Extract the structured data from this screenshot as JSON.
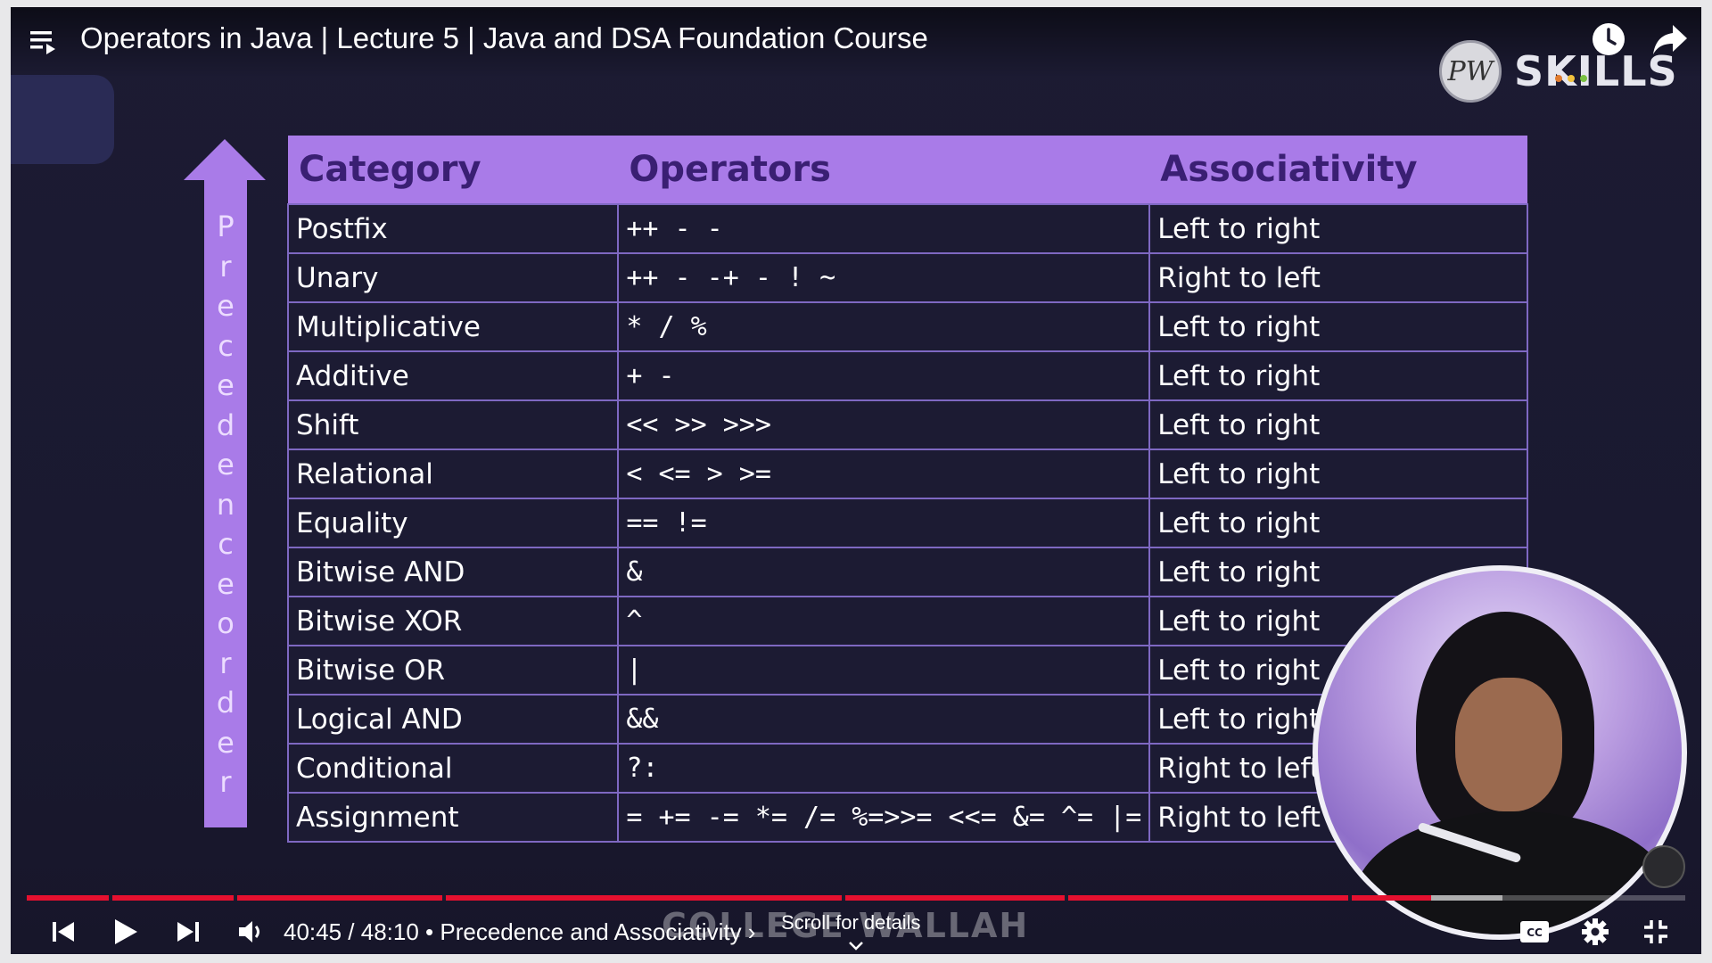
{
  "header": {
    "title": "Operators in Java | Lecture 5 | Java and DSA Foundation Course"
  },
  "brand": {
    "logo_text": "PW",
    "name": "SKILLS",
    "dot_colors": [
      "#e07b2f",
      "#f2c23c",
      "#7ac142"
    ]
  },
  "precedence_label": [
    "P",
    "r",
    "e",
    "c",
    "e",
    "d",
    "e",
    "n",
    "c",
    "e",
    "o",
    "r",
    "d",
    "e",
    "r"
  ],
  "table": {
    "headers": [
      "Category",
      "Operators",
      "Associativity"
    ],
    "rows": [
      {
        "category": "Postfix",
        "operators": "++ - -",
        "associativity": "Left to right"
      },
      {
        "category": "Unary",
        "operators": "++ - -+ - ! ~",
        "associativity": "Right to left"
      },
      {
        "category": "Multiplicative",
        "operators": "* / %",
        "associativity": "Left to right"
      },
      {
        "category": "Additive",
        "operators": "+ -",
        "associativity": "Left to right"
      },
      {
        "category": "Shift",
        "operators": "<<  >> >>>",
        "associativity": "Left to right"
      },
      {
        "category": "Relational",
        "operators": "< <= > >=",
        "associativity": "Left to right"
      },
      {
        "category": "Equality",
        "operators": "== !=",
        "associativity": "Left to right"
      },
      {
        "category": "Bitwise AND",
        "operators": "&",
        "associativity": "Left to right"
      },
      {
        "category": "Bitwise XOR",
        "operators": "^",
        "associativity": "Left to right"
      },
      {
        "category": "Bitwise OR",
        "operators": "|",
        "associativity": "Left to right"
      },
      {
        "category": "Logical AND",
        "operators": "&&",
        "associativity": "Left to right"
      },
      {
        "category": "Conditional",
        "operators": "?:",
        "associativity": "Right to left"
      },
      {
        "category": "Assignment",
        "operators": "= += -= *= /= %=>>= <<= &= ^= |=",
        "associativity": "Right to left"
      }
    ]
  },
  "watermark": "COLLEGE WALLAH",
  "player": {
    "time_display": "40:45 / 48:10",
    "chapter": "• Precedence and Associativity ›",
    "scroll_hint": "Scroll for details",
    "progress_played": 0.8466,
    "progress_buffered": 0.89,
    "accent_color": "#e5102f",
    "buttons": [
      "previous-icon",
      "play-icon",
      "next-icon",
      "volume-icon",
      "captions-icon",
      "settings-icon",
      "exit-fullscreen-icon"
    ]
  }
}
